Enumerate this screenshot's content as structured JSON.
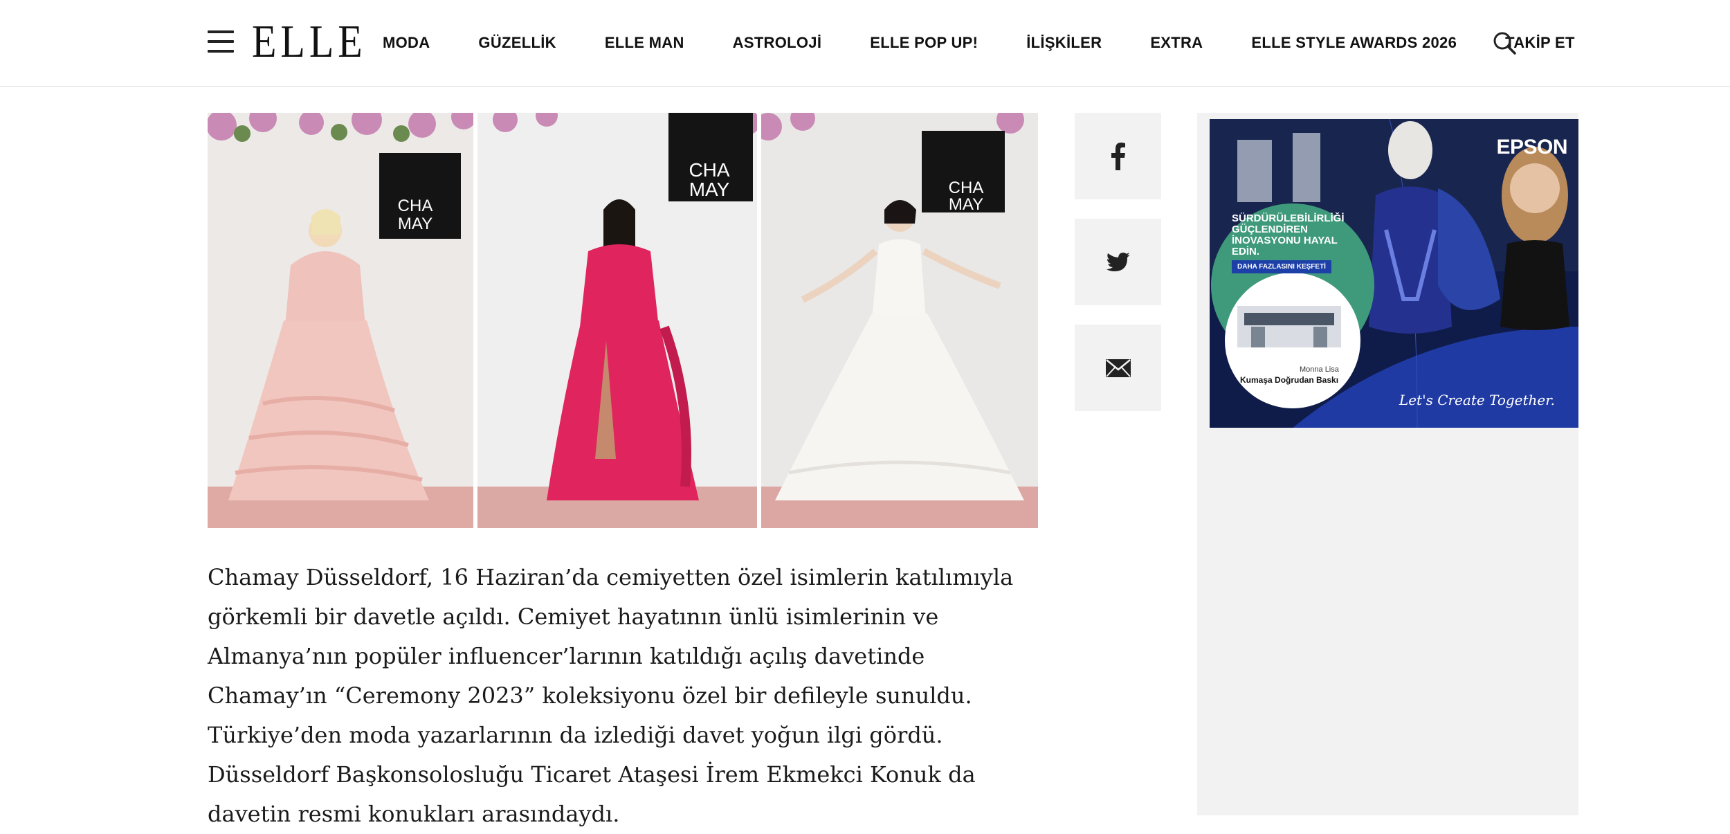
{
  "header": {
    "logo": "ELLE",
    "nav": [
      "MODA",
      "GÜZELLİK",
      "ELLE MAN",
      "ASTROLOJİ",
      "ELLE POP UP!",
      "İLİŞKİLER",
      "EXTRA",
      "ELLE STYLE AWARDS 2026",
      "TAKİP ET"
    ]
  },
  "gallery": {
    "photos": [
      {
        "backdrop_text_1": "CHA",
        "backdrop_text_2": "MAY",
        "dress_color": "#f1c6bf"
      },
      {
        "backdrop_text_1": "CHA",
        "backdrop_text_2": "MAY",
        "dress_color": "#e0245e"
      },
      {
        "backdrop_text_1": "CHA",
        "backdrop_text_2": "MAY",
        "dress_color": "#f7f5f2"
      }
    ]
  },
  "share": {
    "buttons": [
      "facebook-icon",
      "twitter-icon",
      "email-icon"
    ]
  },
  "article": {
    "paragraph": "Chamay Düsseldorf, 16 Haziran’da cemiyetten özel isimlerin katılımıyla görkemli bir davetle açıldı. Cemiyet hayatının ünlü isimlerinin ve Almanya’nın popüler influencer’larının katıldığı açılış davetinde Chamay’ın “Ceremony 2023” koleksiyonu özel bir defileyle sunuldu. Türkiye’den moda yazarlarının da izlediği davet yoğun ilgi gördü. Düsseldorf Başkonsolosluğu Ticaret Ataşesi İrem Ekmekci Konuk da davetin resmi konukları arasındaydı."
  },
  "ad": {
    "brand": "EPSON",
    "headline": "SÜRDÜRÜLEBİLİRLİĞİ GÜÇLENDİREN İNOVASYONU HAYAL EDİN.",
    "cta": "DAHA FAZLASINI KEŞFETİ",
    "caption_small": "Monna Lisa",
    "caption": "Kumaşa Doğrudan Baskı",
    "tagline": "Let's Create Together."
  },
  "colors": {
    "nav_text": "#111111",
    "share_bg": "#f2f2f2",
    "sidebar_bg": "#f2f2f2",
    "ad_navy": "#0f1c4a",
    "ad_green": "#3e9a7a"
  }
}
